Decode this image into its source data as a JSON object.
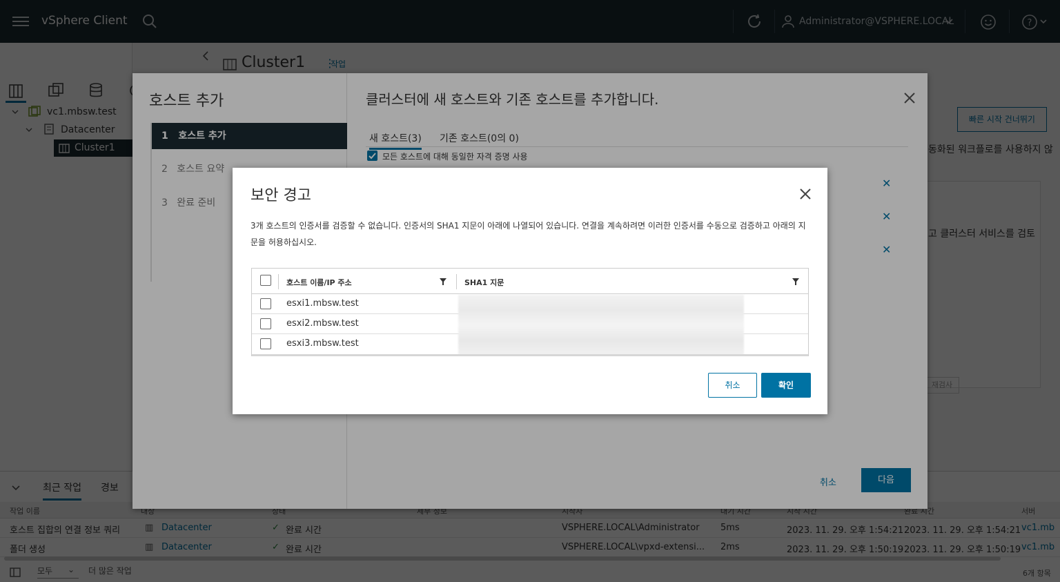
{
  "header": {
    "app_title": "vSphere Client",
    "user": "Administrator@VSPHERE.LOCAL"
  },
  "background": {
    "object_title": "Cluster1",
    "actions_label": "작업",
    "tree": [
      "vc1.mbsw.test",
      "Datacenter",
      "Cluster1"
    ],
    "quick_start_button": "빠른 시작 건너뛰기",
    "right_text_1": "동화된 워크플로를 사용하지 않",
    "right_text_2": "고 클러스터 서비스를 검토",
    "recheck_label": "재검사"
  },
  "tasks": {
    "tabs": [
      "최근 작업",
      "경보"
    ],
    "columns": [
      "작업 이름",
      "대상",
      "상태",
      "세부 정보",
      "시작자",
      "대기 시간",
      "시작 시간",
      "완료 시간",
      "서버"
    ],
    "rows": [
      {
        "name": "호스트 집합의 연결 정보 쿼리",
        "target": "Datacenter",
        "status": "완료 시간",
        "initiator": "VSPHERE.LOCAL\\Administrator",
        "queued": "5ms",
        "start": "2023. 11. 29. 오후 1:54:21",
        "complete": "2023. 11. 29. 오후 1:54:21",
        "server": "vc1.mb"
      },
      {
        "name": "폴더 생성",
        "target": "Datacenter",
        "status": "완료 시간",
        "initiator": "VSPHERE.LOCAL\\vpxd-extensi...",
        "queued": "2ms",
        "start": "2023. 11. 29. 오후 1:50:19",
        "complete": "2023. 11. 29. 오후 1:50:19",
        "server": "vc1.mb"
      }
    ],
    "filter_value": "모두",
    "more_tasks": "더 많은 작업",
    "item_count": "6개 항목"
  },
  "wizard": {
    "title": "호스트 추가",
    "steps": [
      {
        "num": "1",
        "label": "호스트 추가"
      },
      {
        "num": "2",
        "label": "호스트 요약"
      },
      {
        "num": "3",
        "label": "완료 준비"
      }
    ],
    "page_title": "클러스터에 새 호스트와 기존 호스트를 추가합니다.",
    "tabs": [
      "새 호스트(3)",
      "기존 호스트(0의 0)"
    ],
    "same_credentials_label": "모든 호스트에 대해 동일한 자격 증명 사용",
    "cancel": "취소",
    "next": "다음"
  },
  "dialog": {
    "title": "보안 경고",
    "message": "3개 호스트의 인증서를 검증할 수 없습니다. 인증서의 SHA1 지문이 아래에 나열되어 있습니다. 연결을 계속하려면 이러한 인증서를 수동으로 검증하고 아래의 지문을 허용하십시오.",
    "col_host": "호스트 이름/IP 주소",
    "col_sha1": "SHA1 지문",
    "hosts": [
      "esxi1.mbsw.test",
      "esxi2.mbsw.test",
      "esxi3.mbsw.test"
    ],
    "cancel": "취소",
    "ok": "확인"
  }
}
